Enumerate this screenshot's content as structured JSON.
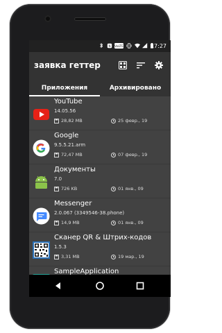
{
  "status_bar": {
    "time": "17:27",
    "icons": [
      "bluetooth-icon",
      "nfc-icon",
      "volte-icon",
      "vibrate-icon",
      "wifi-icon",
      "signal-icon",
      "battery-icon"
    ]
  },
  "app_bar": {
    "title": "заявка геттер",
    "actions": [
      "layout-icon",
      "sort-icon",
      "settings-icon"
    ]
  },
  "tabs": [
    {
      "label": "Приложения",
      "active": true
    },
    {
      "label": "Архивировано",
      "active": false
    }
  ],
  "apps": [
    {
      "name": "YouTube",
      "version": "14.05.56",
      "size": "28,82 MB",
      "date": "25 февр., 19",
      "icon": "youtube-icon"
    },
    {
      "name": "Google",
      "version": "9.5.5.21.arm",
      "size": "72,47 MB",
      "date": "07 февр., 19",
      "icon": "google-icon"
    },
    {
      "name": "Документы",
      "version": "7.0",
      "size": "726 KB",
      "date": "01 янв., 09",
      "icon": "android-icon"
    },
    {
      "name": "Messenger",
      "version": "2.0.067 (3349546-38.phone)",
      "size": "14,9 MB",
      "date": "01 янв., 09",
      "icon": "messenger-icon"
    },
    {
      "name": "Сканер QR & Штрих-кодов",
      "version": "1.5.3",
      "size": "3,31 MB",
      "date": "19 мар., 19",
      "icon": "qr-code-icon"
    },
    {
      "name": "SampleApplication",
      "version": "",
      "size": "",
      "date": "",
      "icon": "sample-app-icon"
    }
  ],
  "nav_bar": [
    "back-icon",
    "home-icon",
    "recents-icon"
  ],
  "colors": {
    "screen_bg": "#333333",
    "status_bg": "#212121",
    "row_bg": "#424242",
    "text": "#ffffff",
    "youtube_red": "#e62117",
    "android_green": "#8bc34a",
    "messenger_blue": "#448aff"
  }
}
